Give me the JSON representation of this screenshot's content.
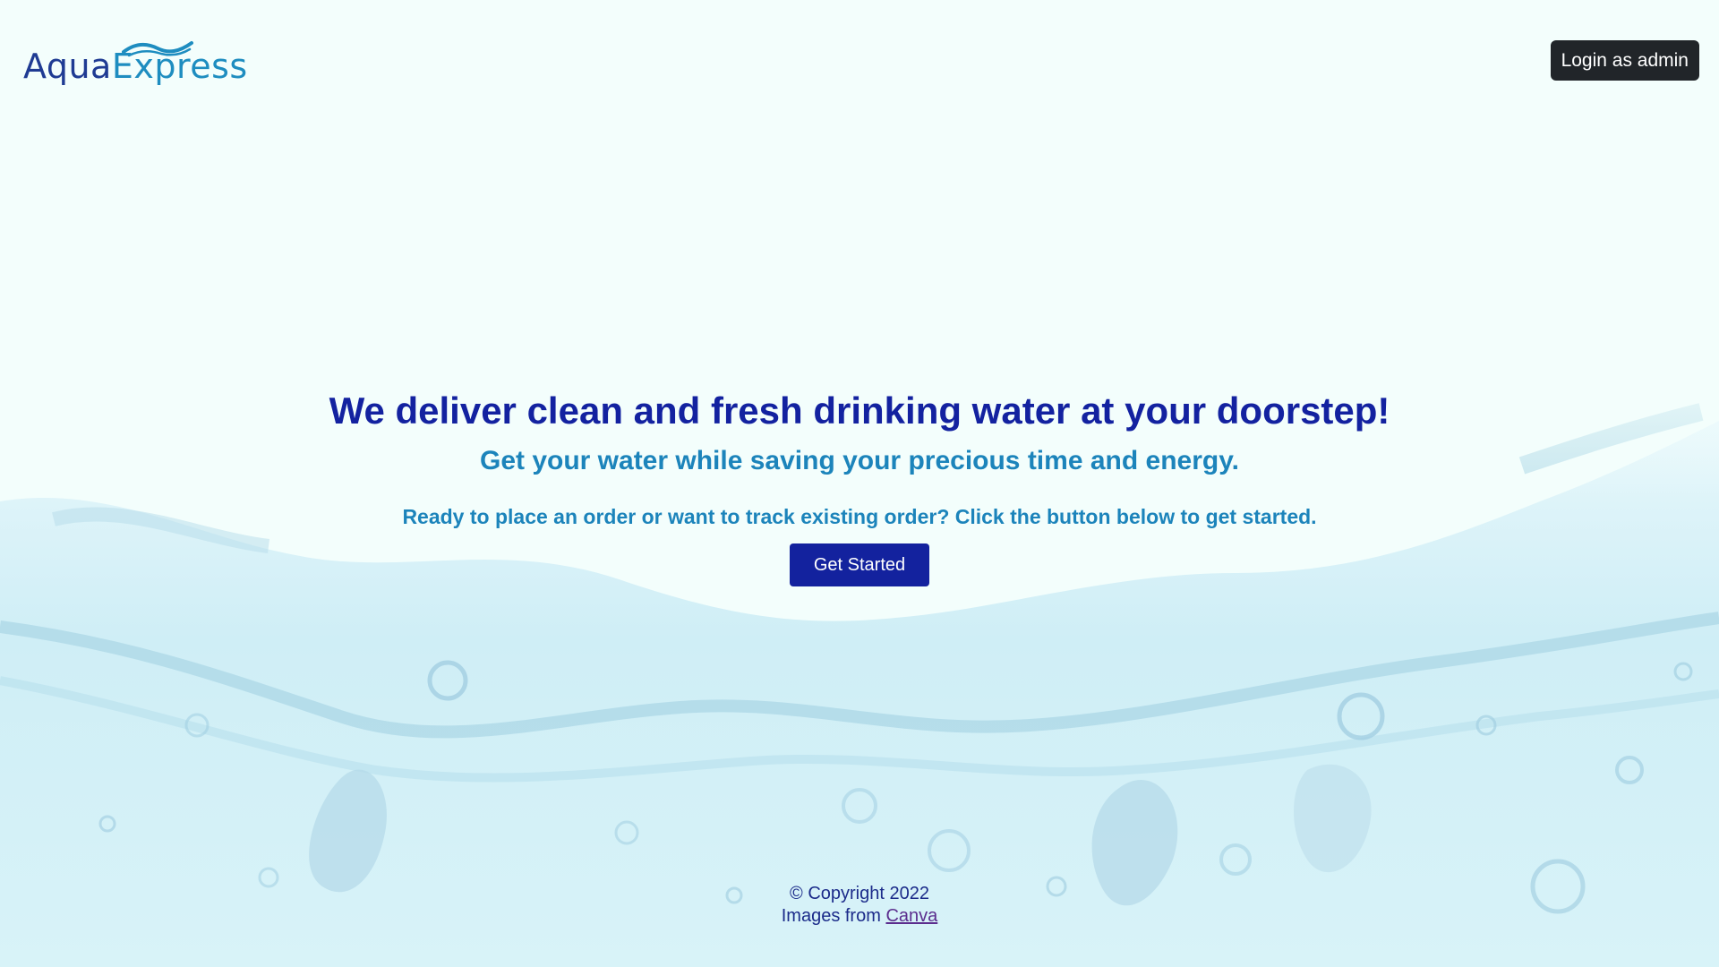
{
  "header": {
    "logo": {
      "part1": "Aqua",
      "part2": "Express"
    },
    "admin_button": "Login as admin"
  },
  "hero": {
    "title": "We deliver clean and fresh drinking water at your doorstep!",
    "subtitle": "Get your water while saving your precious time and energy.",
    "cta_text": "Ready to place an order or want to track existing order? Click the button below to get started.",
    "button_label": "Get Started"
  },
  "footer": {
    "copyright": "© Copyright 2022",
    "images_prefix": "Images from",
    "images_link": "Canva"
  },
  "colors": {
    "brand_dark": "#13229e",
    "brand_light": "#1c84bb",
    "admin_button_bg": "#212529",
    "background": "#f3fefc"
  },
  "icons": {
    "logo_wave": "wave-icon",
    "background": "water-splash-image"
  }
}
